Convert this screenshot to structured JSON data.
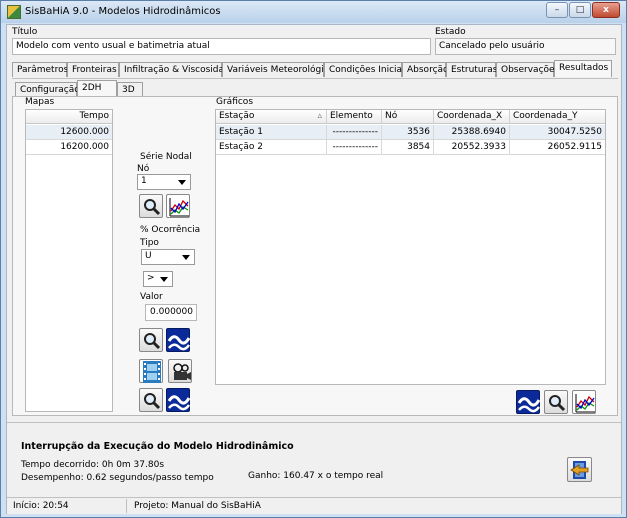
{
  "window": {
    "title": "SisBaHiA 9.0 - Modelos Hidrodinâmicos",
    "minimize": "–",
    "maximize": "□",
    "close": "x"
  },
  "header": {
    "titulo_label": "Título",
    "titulo_value": "Modelo com vento usual e batimetria atual",
    "estado_label": "Estado",
    "estado_value": "Cancelado pelo usuário"
  },
  "tabs": [
    "Parâmetros",
    "Fronteiras",
    "Infiltração & Viscosidade",
    "Variáveis Meteorológicas",
    "Condições Iniciais",
    "Absorção",
    "Estruturas",
    "Observações",
    "Resultados"
  ],
  "subtabs": [
    "Configuração",
    "2DH",
    "3D"
  ],
  "mapas": {
    "label": "Mapas",
    "header": "Tempo",
    "rows": [
      "12600.000",
      "16200.000"
    ]
  },
  "serie_nodal": {
    "label": "Série Nodal",
    "no_label": "Nó",
    "no_value": "1"
  },
  "ocorrencia": {
    "label": "% Ocorrência",
    "tipo_label": "Tipo",
    "tipo_value": "U",
    "op_value": ">",
    "valor_label": "Valor",
    "valor_value": "0.000000"
  },
  "graficos": {
    "label": "Gráficos",
    "columns": [
      "Estação",
      "Elemento",
      "Nó",
      "Coordenada_X",
      "Coordenada_Y"
    ],
    "rows": [
      [
        "Estação 1",
        "--------------",
        "3536",
        "25388.6940",
        "30047.5250"
      ],
      [
        "Estação 2",
        "--------------",
        "3854",
        "20552.3933",
        "26052.9115"
      ]
    ]
  },
  "status": {
    "heading": "Interrupção da Execução do Modelo Hidrodinâmico",
    "tempo": "Tempo decorrido:  0h  0m 37.80s",
    "desempenho": "Desempenho: 0.62 segundos/passo tempo",
    "ganho": "Ganho: 160.47 x o tempo real"
  },
  "footer": {
    "inicio": "Início: 20:54",
    "projeto": "Projeto: Manual do SisBaHiA"
  }
}
